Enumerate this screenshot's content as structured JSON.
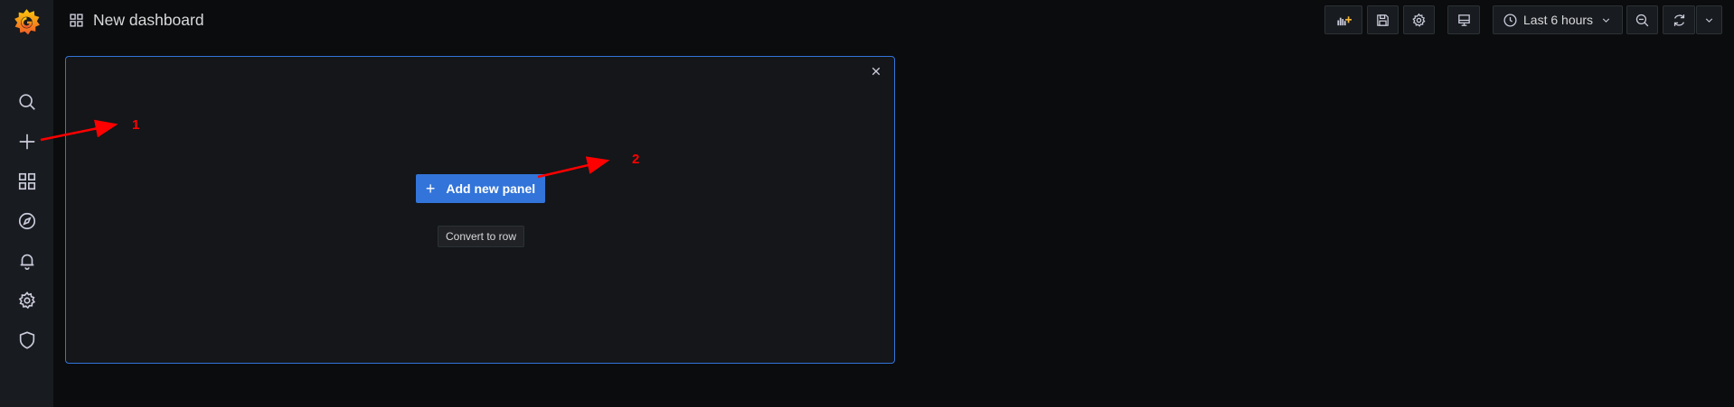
{
  "sidebar": {
    "items": [
      {
        "icon": "search-icon"
      },
      {
        "icon": "plus-icon"
      },
      {
        "icon": "dashboards-icon"
      },
      {
        "icon": "compass-icon"
      },
      {
        "icon": "bell-icon"
      },
      {
        "icon": "gear-icon"
      },
      {
        "icon": "shield-icon"
      }
    ]
  },
  "header": {
    "title": "New dashboard",
    "time_range": "Last 6 hours"
  },
  "panel": {
    "add_button_label": "Add new panel",
    "convert_button_label": "Convert to row"
  },
  "annotations": {
    "label_1": "1",
    "label_2": "2",
    "color": "#ff0000"
  },
  "colors": {
    "accent": "#3274d9",
    "background": "#0b0c0e",
    "sidebar": "#181b1f",
    "panel": "#141619",
    "logo_orange": "#f46800"
  }
}
